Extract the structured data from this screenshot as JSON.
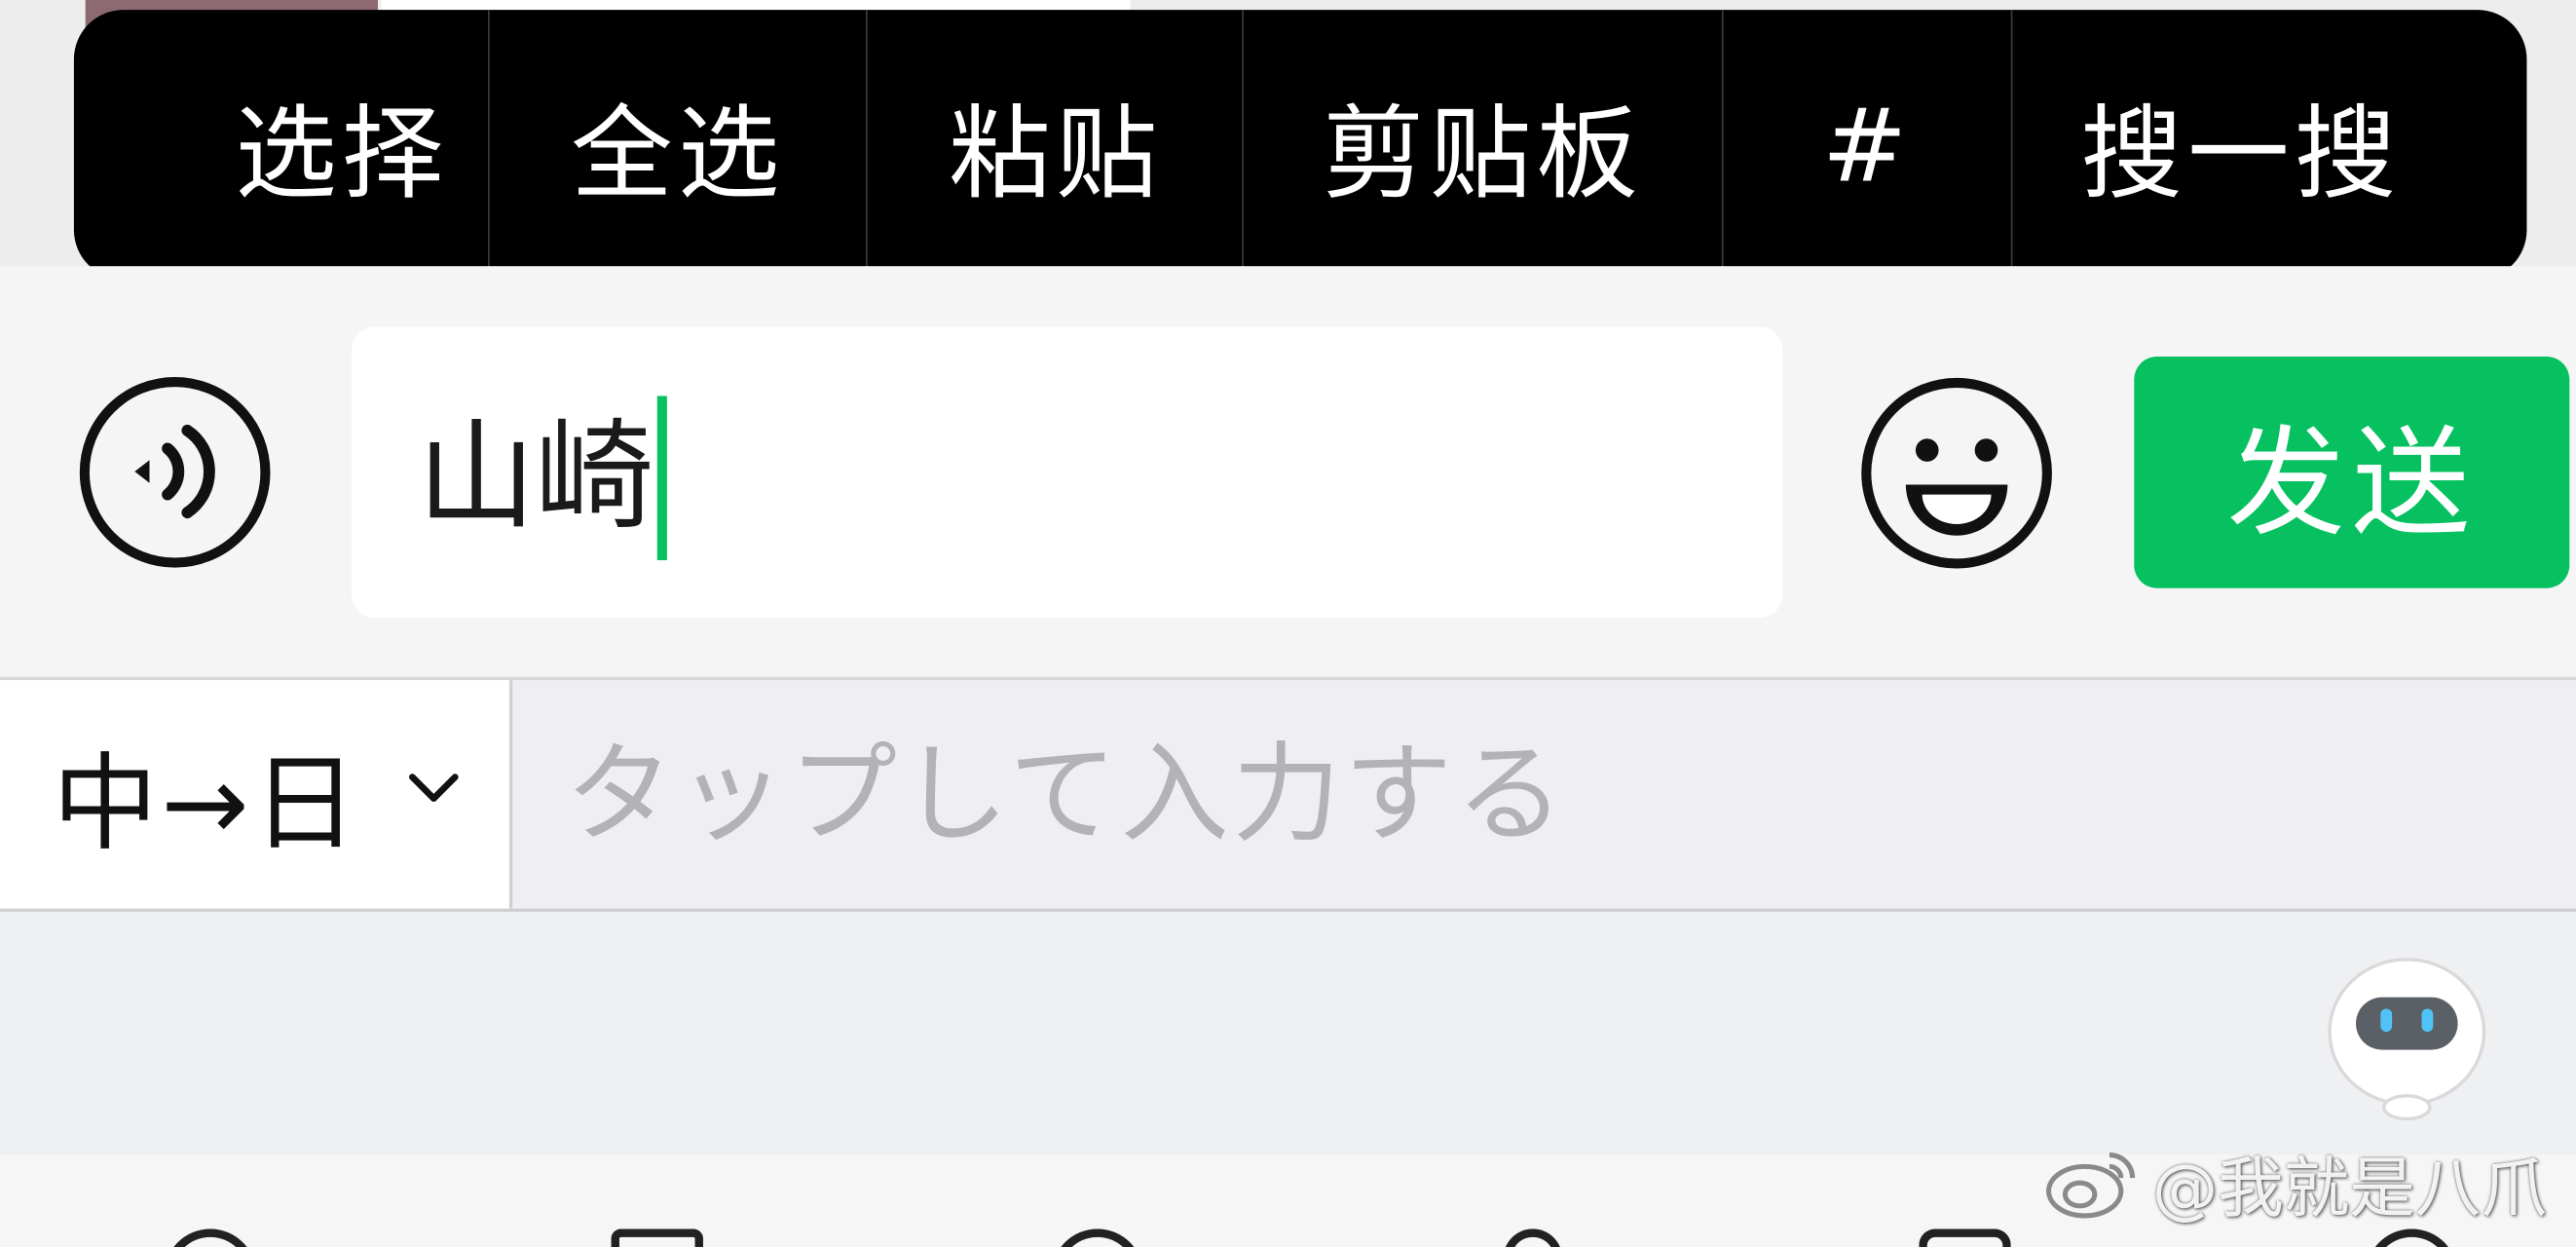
{
  "context_menu": {
    "items": [
      {
        "label": "选择"
      },
      {
        "label": "全选"
      },
      {
        "label": "粘贴"
      },
      {
        "label": "剪贴板"
      },
      {
        "label": "#"
      },
      {
        "label": "搜一搜"
      }
    ]
  },
  "composer": {
    "text": "山崎",
    "send_label": "发送",
    "voice_icon": "voice-icon",
    "emoji_icon": "emoji-icon"
  },
  "translator": {
    "language_pair": "中→日",
    "placeholder": "タップして入力する"
  },
  "assistant": {
    "icon": "robot-assistant-icon"
  },
  "watermark": {
    "text": "@我就是八爪"
  },
  "colors": {
    "accent": "#07c160",
    "menu_bg": "#000000",
    "placeholder": "#b3b3b6"
  }
}
